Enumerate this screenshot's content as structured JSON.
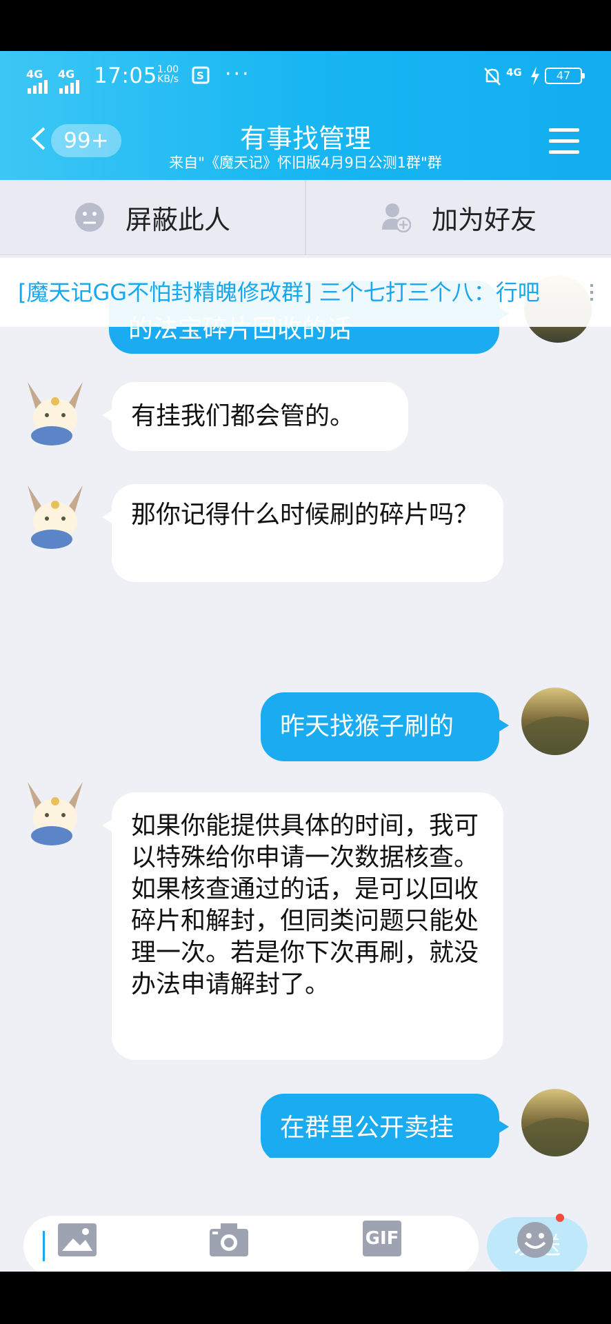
{
  "status": {
    "time": "17:05",
    "speed_value": "1.00",
    "speed_unit": "KB/s",
    "battery": "47",
    "dots": "···",
    "sig1": "4G",
    "sig2": "4G",
    "net_right": "4G"
  },
  "header": {
    "back_count": "99+",
    "title": "有事找管理",
    "subtitle": "来自\"《魔天记》怀旧版4月9日公测1群\"群"
  },
  "actions": {
    "block_label": "屏蔽此人",
    "add_friend_label": "加为好友"
  },
  "notice": {
    "text": "[魔天记GG不怕封精魄修改群] 三个七打三个八：行吧"
  },
  "messages": [
    {
      "side": "out",
      "text": "的法宝碎片回收的话"
    },
    {
      "side": "in",
      "text": "有挂我们都会管的。"
    },
    {
      "side": "in",
      "text": "那你记得什么时候刷的碎片吗？"
    },
    {
      "side": "out",
      "text": "昨天找猴子刷的"
    },
    {
      "side": "in",
      "text": "如果你能提供具体的时间，我可以特殊给你申请一次数据核查。如果核查通过的话，是可以回收碎片和解封，但同类问题只能处理一次。若是你下次再刷，就没办法申请解封了。"
    },
    {
      "side": "out",
      "text": "在群里公开卖挂"
    }
  ],
  "input": {
    "value": "",
    "send_label": "发送"
  },
  "toolbar": {
    "icons": [
      "image-icon",
      "camera-icon",
      "gif-icon",
      "emoji-icon"
    ],
    "gif_label": "GIF"
  },
  "colors": {
    "accent": "#1aabf1",
    "header": "#18b6f2",
    "notice_text": "#17a7ee"
  }
}
